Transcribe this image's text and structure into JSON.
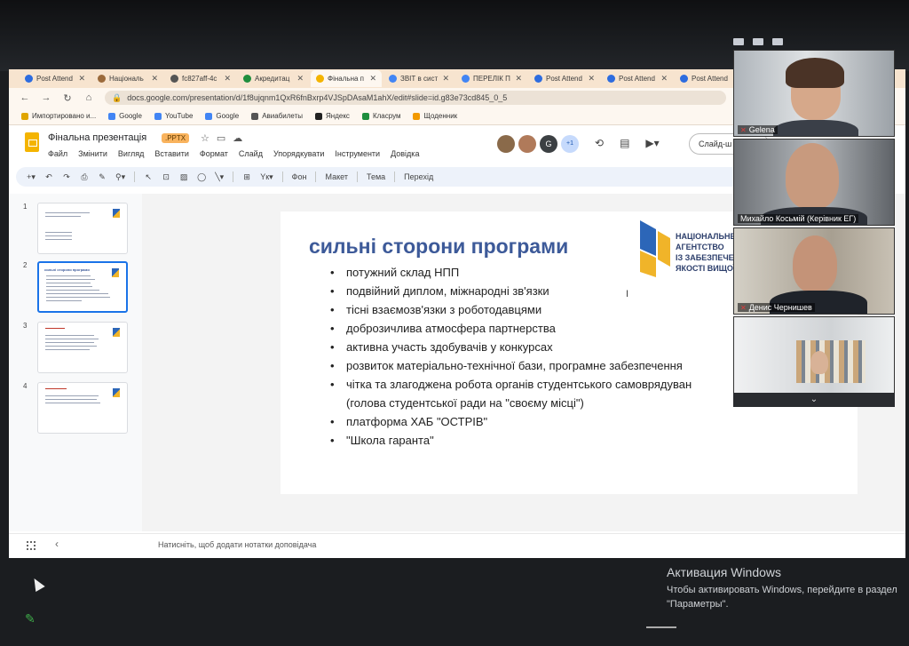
{
  "browser": {
    "tabs": [
      {
        "label": "Post Attend",
        "color": "#2d6cdf",
        "active": false
      },
      {
        "label": "Національ",
        "color": "#9b6a3b",
        "active": false
      },
      {
        "label": "fc827aff-4c",
        "color": "#555555",
        "active": false
      },
      {
        "label": "Акредитац",
        "color": "#1f8e3d",
        "active": false
      },
      {
        "label": "Фінальна п",
        "color": "#f4b400",
        "active": true
      },
      {
        "label": "ЗВІТ в сист",
        "color": "#4285f4",
        "active": false
      },
      {
        "label": "ПЕРЕЛІК П",
        "color": "#4285f4",
        "active": false
      },
      {
        "label": "Post Attend",
        "color": "#2d6cdf",
        "active": false
      },
      {
        "label": "Post Attend",
        "color": "#2d6cdf",
        "active": false
      },
      {
        "label": "Post Attend",
        "color": "#2d6cdf",
        "active": false
      }
    ],
    "url": "docs.google.com/presentation/d/1f8ujqnm1QxR6fnBxrp4VJSpDAsaM1ahX/edit#slide=id.g83e73cd845_0_5",
    "bookmarks": [
      {
        "label": "Импортировано и...",
        "color": "#e0a500"
      },
      {
        "label": "Google",
        "color": "#4285f4"
      },
      {
        "label": "YouTube",
        "color": "#4285f4"
      },
      {
        "label": "Google",
        "color": "#4285f4"
      },
      {
        "label": "Авиабилеты",
        "color": "#555555"
      },
      {
        "label": "Яндекс",
        "color": "#222222"
      },
      {
        "label": "Класрум",
        "color": "#1e8e3e"
      },
      {
        "label": "Щоденник",
        "color": "#f29900"
      }
    ]
  },
  "slides_app": {
    "doc_title": "Фінальна презентація",
    "badge": ".PPTX",
    "menu": [
      "Файл",
      "Змінити",
      "Вигляд",
      "Вставити",
      "Формат",
      "Слайд",
      "Упорядкувати",
      "Інструменти",
      "Довідка"
    ],
    "avatar_letter": "G",
    "more_collaborators": "+1",
    "slideshow_label": "Слайд-ш",
    "toolbar": {
      "background": "Фон",
      "layout": "Макет",
      "theme": "Тема",
      "transition": "Перехід"
    },
    "slide_numbers": [
      "1",
      "2",
      "3",
      "4"
    ],
    "notes_placeholder": "Натисніть, щоб додати нотатки доповідача"
  },
  "slide": {
    "title": "сильні сторони програми",
    "bullets": [
      "потужний склад НПП",
      "подвійний диплом, міжнародні зв'язки",
      "тісні взаємозв'язки з роботодавцями",
      "доброзичлива атмосфера партнерства",
      "активна участь здобувачів у конкурсах",
      "розвиток матеріально-технічної бази, програмне забезпечення",
      "чітка та злагоджена робота органів студентського самоврядуван"
    ],
    "bullet_sub": "(голова студентської ради на \"своєму місці\")",
    "bullets_after": [
      "платформа ХАБ \"ОСТРІВ\"",
      "\"Школа гаранта\""
    ],
    "logo_lines": [
      "НАЦІОНАЛЬНЕ",
      "АГЕНТСТВО",
      "ІЗ ЗАБЕЗПЕЧЕН",
      "ЯКОСТІ ВИЩОЇ О"
    ],
    "title_color": "#3d5a99"
  },
  "zoom": {
    "participants": [
      {
        "name": "Gelena"
      },
      {
        "name": "Михайло Косьмій (Керівник ЕГ)"
      },
      {
        "name": "Денис Чернишев"
      },
      {
        "name": ""
      }
    ]
  },
  "windows": {
    "title": "Активация Windows",
    "desc": "Чтобы активировать Windows, перейдите в раздел \"Параметры\"."
  }
}
